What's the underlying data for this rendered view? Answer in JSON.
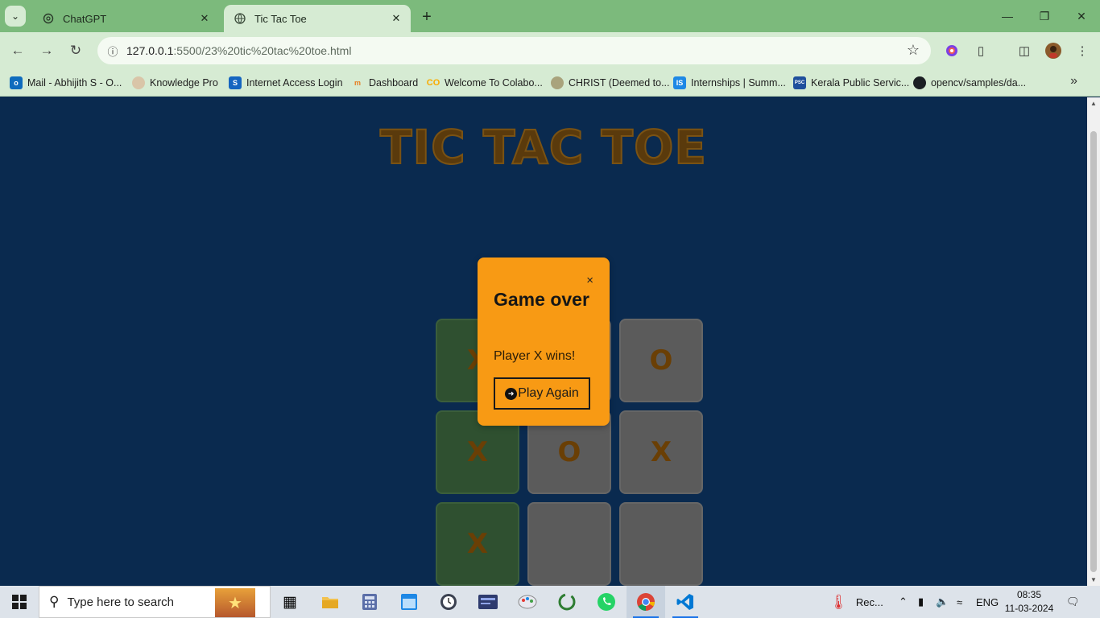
{
  "browser": {
    "tabs": [
      {
        "title": "ChatGPT",
        "icon": "chatgpt-icon",
        "active": false
      },
      {
        "title": "Tic Tac Toe",
        "icon": "globe-icon",
        "active": true
      }
    ],
    "url_host": "127.0.0.1",
    "url_rest": ":5500/23%20tic%20tac%20toe.html",
    "bookmarks": [
      {
        "label": "Mail - Abhijith S - O...",
        "icon": "outlook-icon",
        "color": "#0f6cbd"
      },
      {
        "label": "Knowledge Pro",
        "icon": "knowledge-pro-icon",
        "color": "#b8956a"
      },
      {
        "label": "Internet Access Login",
        "icon": "sophos-icon",
        "color": "#1565c0"
      },
      {
        "label": "Dashboard",
        "icon": "moodle-icon",
        "color": "#e67e22"
      },
      {
        "label": "Welcome To Colabo...",
        "icon": "colab-icon",
        "color": "#f9ab00"
      },
      {
        "label": "CHRIST (Deemed to...",
        "icon": "christ-icon",
        "color": "#8a8a5c"
      },
      {
        "label": "Internships | Summ...",
        "icon": "internshala-icon",
        "color": "#1e88e5"
      },
      {
        "label": "Kerala Public Servic...",
        "icon": "kpsc-icon",
        "color": "#1f4f9c"
      },
      {
        "label": "opencv/samples/da...",
        "icon": "github-icon",
        "color": "#1b1f23"
      }
    ]
  },
  "page": {
    "title": "TIC TAC TOE",
    "board": [
      {
        "mark": "X",
        "win": true
      },
      {
        "mark": "",
        "win": false
      },
      {
        "mark": "O",
        "win": false
      },
      {
        "mark": "X",
        "win": true
      },
      {
        "mark": "O",
        "win": false
      },
      {
        "mark": "X",
        "win": false
      },
      {
        "mark": "X",
        "win": true
      },
      {
        "mark": "",
        "win": false
      },
      {
        "mark": "",
        "win": false
      }
    ],
    "modal": {
      "close_label": "×",
      "heading": "Game over",
      "message": "Player X wins!",
      "button_label": "Play Again"
    }
  },
  "taskbar": {
    "search_placeholder": "Type here to search",
    "weather_label": "Rec...",
    "language": "ENG",
    "time": "08:35",
    "date": "11-03-2024"
  },
  "colors": {
    "page_bg": "#0a2a4f",
    "modal_bg": "#f89a14",
    "title_color": "#5a3a0c",
    "win_cell": "#2f5030",
    "cell": "#5b5b5b",
    "browser_frame": "#7cba7c"
  }
}
